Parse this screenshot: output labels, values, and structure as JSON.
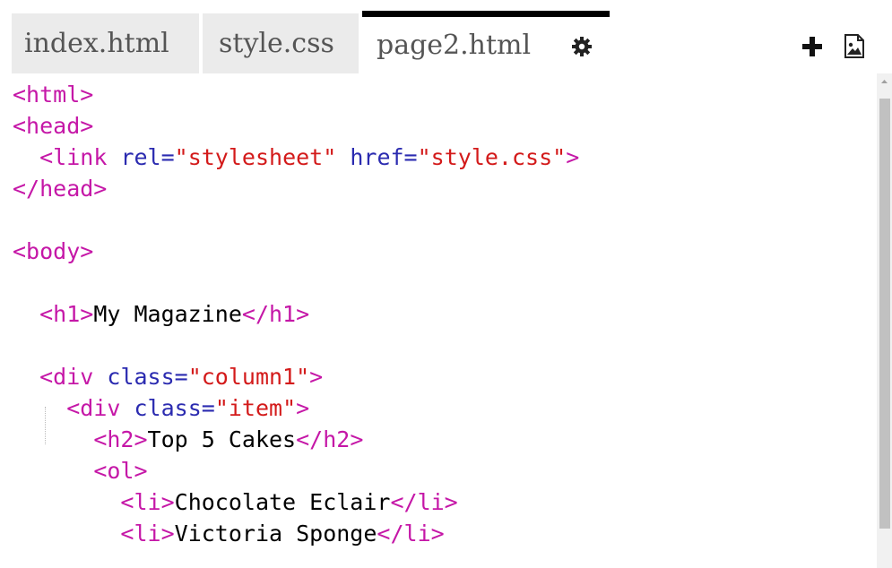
{
  "tabs": [
    {
      "label": "index.html"
    },
    {
      "label": "style.css"
    },
    {
      "label": "page2.html"
    }
  ],
  "icons": {
    "settings": "gear-icon",
    "add_file": "plus-icon",
    "add_image": "image-icon"
  },
  "colors": {
    "tag": "#c517a7",
    "attribute": "#2b2bb0",
    "string": "#d31a1a",
    "text": "#000000",
    "active_tab_border": "#000000"
  },
  "code_lines": [
    [
      {
        "t": "tag",
        "v": "<html>"
      }
    ],
    [
      {
        "t": "tag",
        "v": "<head>"
      }
    ],
    [
      {
        "t": "txt",
        "v": "  "
      },
      {
        "t": "tag",
        "v": "<link"
      },
      {
        "t": "txt",
        "v": " "
      },
      {
        "t": "attr",
        "v": "rel="
      },
      {
        "t": "str",
        "v": "\"stylesheet\""
      },
      {
        "t": "txt",
        "v": " "
      },
      {
        "t": "attr",
        "v": "href="
      },
      {
        "t": "str",
        "v": "\"style.css\""
      },
      {
        "t": "tag",
        "v": ">"
      }
    ],
    [
      {
        "t": "tag",
        "v": "</head>"
      }
    ],
    [],
    [
      {
        "t": "tag",
        "v": "<body>"
      }
    ],
    [],
    [
      {
        "t": "txt",
        "v": "  "
      },
      {
        "t": "tag",
        "v": "<h1>"
      },
      {
        "t": "txt",
        "v": "My Magazine"
      },
      {
        "t": "tag",
        "v": "</h1>"
      }
    ],
    [],
    [
      {
        "t": "txt",
        "v": "  "
      },
      {
        "t": "tag",
        "v": "<div"
      },
      {
        "t": "txt",
        "v": " "
      },
      {
        "t": "attr",
        "v": "class="
      },
      {
        "t": "str",
        "v": "\"column1\""
      },
      {
        "t": "tag",
        "v": ">"
      }
    ],
    [
      {
        "t": "txt",
        "v": "    "
      },
      {
        "t": "tag",
        "v": "<div"
      },
      {
        "t": "txt",
        "v": " "
      },
      {
        "t": "attr",
        "v": "class="
      },
      {
        "t": "str",
        "v": "\"item\""
      },
      {
        "t": "tag",
        "v": ">"
      }
    ],
    [
      {
        "t": "txt",
        "v": "      "
      },
      {
        "t": "tag",
        "v": "<h2>"
      },
      {
        "t": "txt",
        "v": "Top 5 Cakes"
      },
      {
        "t": "tag",
        "v": "</h2>"
      }
    ],
    [
      {
        "t": "txt",
        "v": "      "
      },
      {
        "t": "tag",
        "v": "<ol>"
      }
    ],
    [
      {
        "t": "txt",
        "v": "        "
      },
      {
        "t": "tag",
        "v": "<li>"
      },
      {
        "t": "txt",
        "v": "Chocolate Eclair"
      },
      {
        "t": "tag",
        "v": "</li>"
      }
    ],
    [
      {
        "t": "txt",
        "v": "        "
      },
      {
        "t": "tag",
        "v": "<li>"
      },
      {
        "t": "txt",
        "v": "Victoria Sponge"
      },
      {
        "t": "tag",
        "v": "</li>"
      }
    ]
  ]
}
